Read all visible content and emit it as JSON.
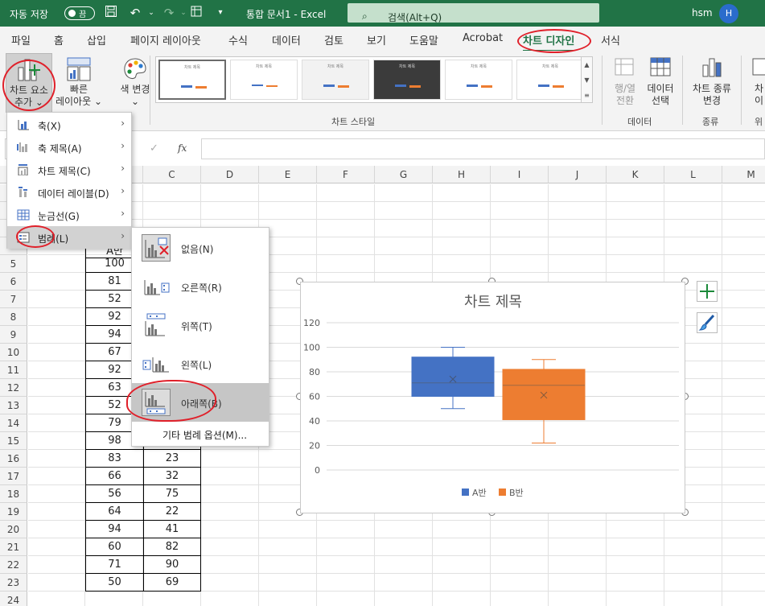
{
  "titlebar": {
    "autosave_label": "자동 저장",
    "autosave_state": "끔",
    "doc_title": "통합 문서1  -  Excel",
    "search_placeholder": "검색(Alt+Q)",
    "user_name": "hsm",
    "user_initial": "H",
    "accent_color": "#217346"
  },
  "tabs": [
    "파일",
    "홈",
    "삽입",
    "페이지 레이아웃",
    "수식",
    "데이터",
    "검토",
    "보기",
    "도움말",
    "Acrobat",
    "차트 디자인",
    "서식"
  ],
  "active_tab": "차트 디자인",
  "ribbon": {
    "add_element_l1": "차트 요소",
    "add_element_l2": "추가",
    "quick_layout_l1": "빠른",
    "quick_layout_l2": "레이아웃",
    "change_color": "색 변경",
    "chart_styles_group": "차트 스타일",
    "switch_l1": "행/열",
    "switch_l2": "전환",
    "select_data_l1": "데이터",
    "select_data_l2": "선택",
    "data_group": "데이터",
    "change_type_l1": "차트 종류",
    "change_type_l2": "변경",
    "type_group": "종류",
    "move_l1": "차",
    "move_l2": "이",
    "location_group": "위"
  },
  "formula_bar": {
    "fx": "fx"
  },
  "menu_add_element": [
    {
      "label": "축(X)",
      "icon": "axes-icon"
    },
    {
      "label": "축 제목(A)",
      "icon": "axis-title-icon"
    },
    {
      "label": "차트 제목(C)",
      "icon": "chart-title-icon"
    },
    {
      "label": "데이터 레이블(D)",
      "icon": "data-labels-icon"
    },
    {
      "label": "눈금선(G)",
      "icon": "gridlines-icon"
    },
    {
      "label": "범례(L)",
      "icon": "legend-icon"
    }
  ],
  "menu_legend": [
    {
      "label": "없음(N)",
      "icon": "legend-none-icon"
    },
    {
      "label": "오른쪽(R)",
      "icon": "legend-right-icon"
    },
    {
      "label": "위쪽(T)",
      "icon": "legend-top-icon"
    },
    {
      "label": "왼쪽(L)",
      "icon": "legend-left-icon"
    },
    {
      "label": "아래쪽(B)",
      "icon": "legend-bottom-icon"
    }
  ],
  "menu_legend_more": "기타 범례 옵션(M)...",
  "columns": [
    "C",
    "D",
    "E",
    "F",
    "G",
    "H",
    "I",
    "J",
    "K",
    "L",
    "M"
  ],
  "rows": [
    "5",
    "6",
    "7",
    "8",
    "9",
    "10",
    "11",
    "12",
    "13",
    "14",
    "15",
    "16",
    "17",
    "18",
    "19",
    "20",
    "21",
    "22",
    "23",
    "24"
  ],
  "header_cell_partial": "A반",
  "col_b_values": [
    "100",
    "81",
    "52",
    "92",
    "94",
    "67",
    "92",
    "63",
    "52",
    "79",
    "98",
    "83",
    "66",
    "56",
    "64",
    "94",
    "60",
    "71",
    "50"
  ],
  "col_c_values": [
    "23",
    "32",
    "75",
    "22",
    "41",
    "82",
    "90",
    "69"
  ],
  "chart": {
    "title": "차트 제목",
    "series_a_color": "#4472c4",
    "series_b_color": "#ed7d31"
  },
  "chart_data": {
    "type": "box",
    "title": "차트 제목",
    "xlabel": "",
    "ylabel": "",
    "ylim": [
      0,
      120
    ],
    "yticks": [
      0,
      20,
      40,
      60,
      80,
      100,
      120
    ],
    "legend_position": "bottom",
    "series": [
      {
        "name": "A반",
        "min": 50,
        "q1": 60,
        "median": 71,
        "q3": 92,
        "max": 100,
        "mean": 74
      },
      {
        "name": "B반",
        "min": 22,
        "q1": 41,
        "median": 69,
        "q3": 82,
        "max": 90,
        "mean": 61
      }
    ]
  }
}
